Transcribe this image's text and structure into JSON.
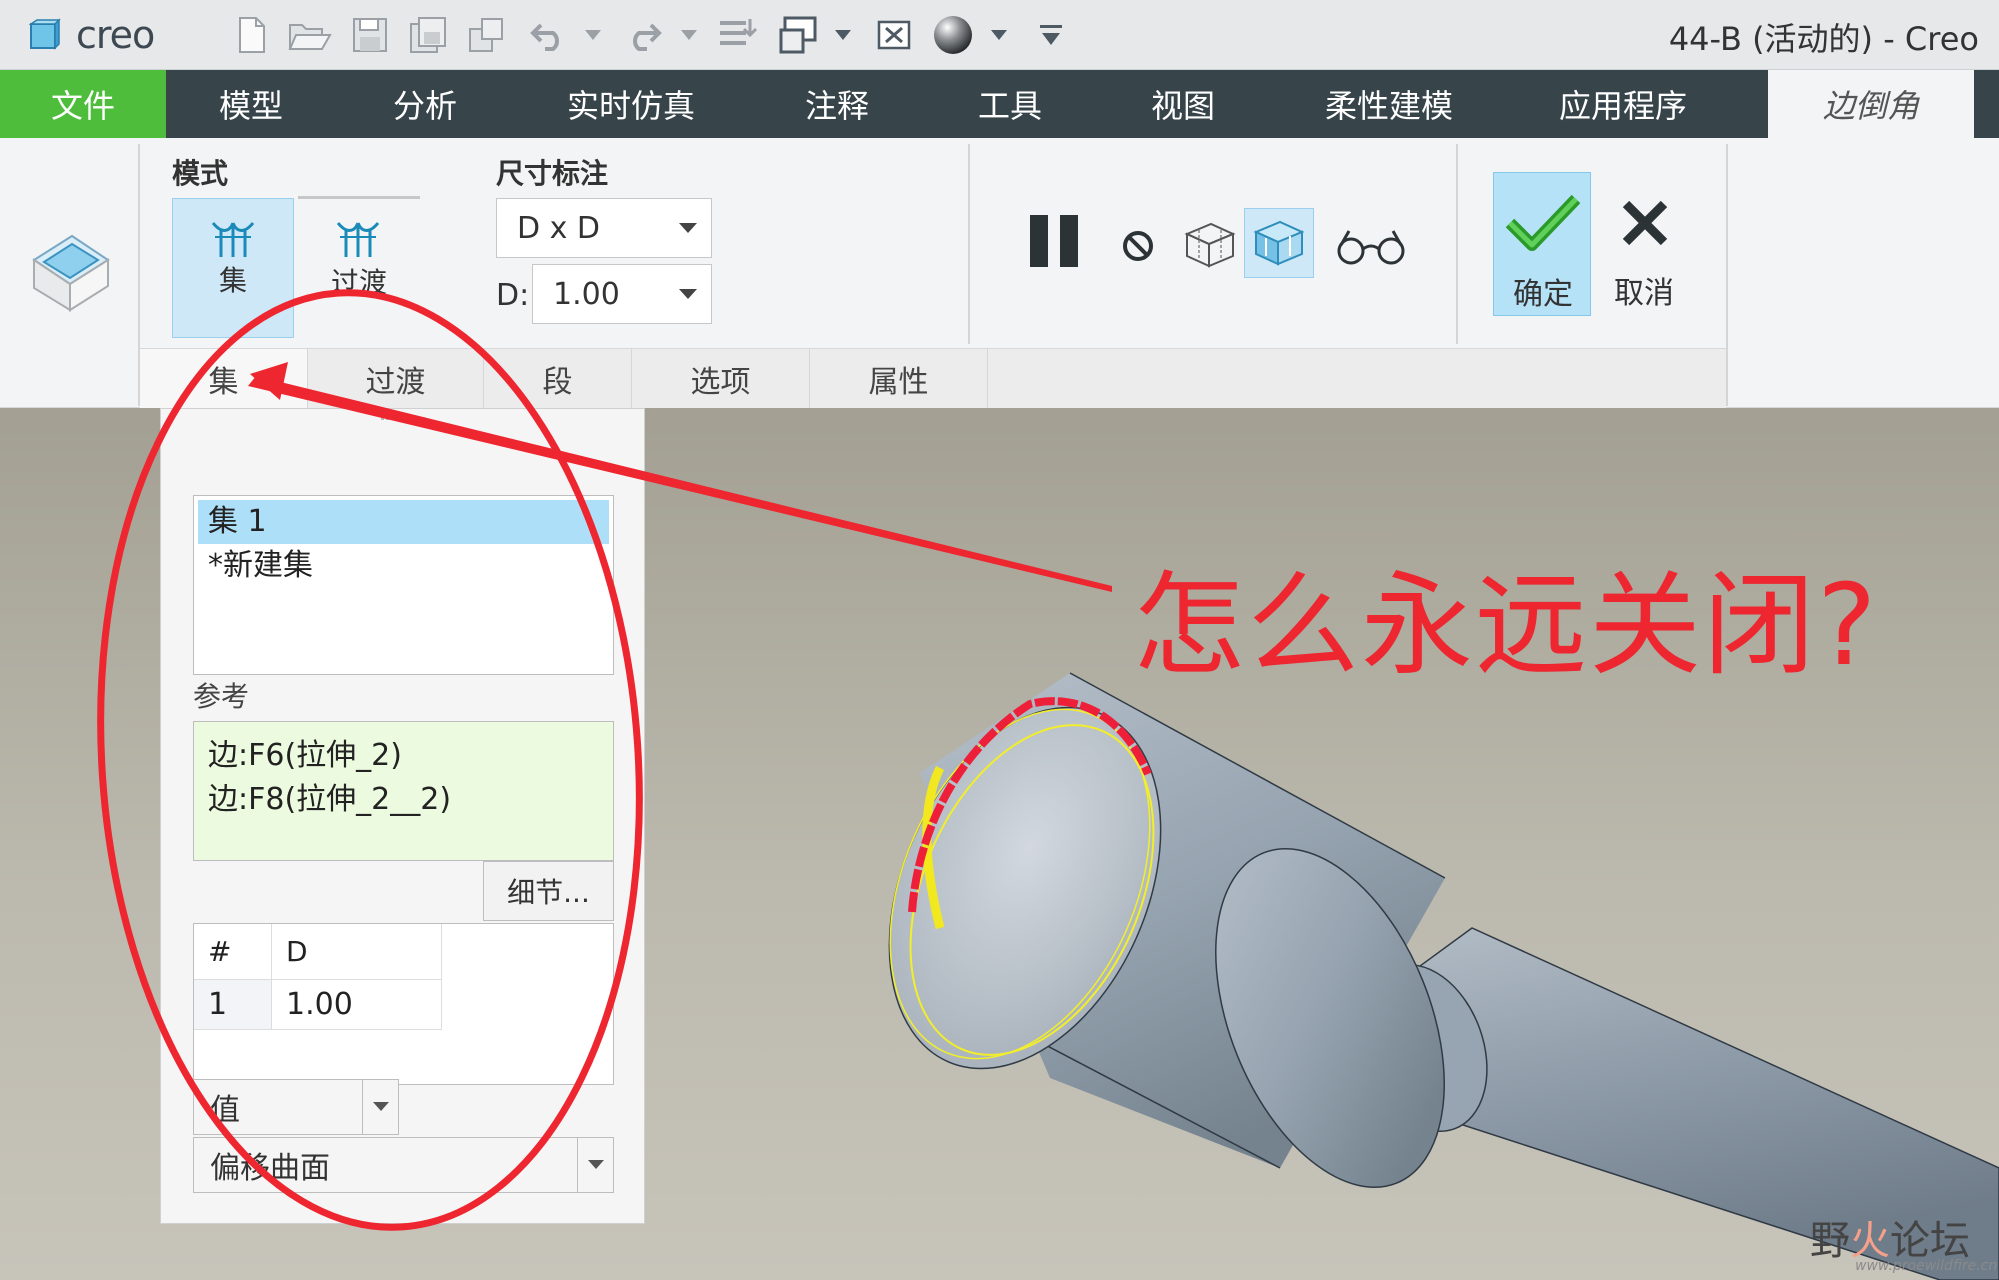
{
  "app": {
    "logo_text": "creo",
    "window_title": "44-B (活动的) - Creo"
  },
  "menu": {
    "items": [
      "文件",
      "模型",
      "分析",
      "实时仿真",
      "注释",
      "工具",
      "视图",
      "柔性建模",
      "应用程序"
    ],
    "active_tab": "边倒角"
  },
  "ribbon": {
    "mode_group": {
      "label": "模式",
      "buttons": [
        {
          "label": "集",
          "selected": true
        },
        {
          "label": "过渡",
          "selected": false
        }
      ]
    },
    "dimension_group": {
      "label": "尺寸标注",
      "type_value": "D x D",
      "d_label": "D:",
      "d_value": "1.00"
    },
    "ok_label": "确定",
    "cancel_label": "取消"
  },
  "tabs": [
    "集",
    "过渡",
    "段",
    "选项",
    "属性"
  ],
  "panel": {
    "sets": [
      "集 1",
      "*新建集"
    ],
    "ref_label": "参考",
    "refs": [
      "边:F6(拉伸_2)",
      "边:F8(拉伸_2__2)"
    ],
    "detail_button": "细节...",
    "table": {
      "headers": [
        "#",
        "D"
      ],
      "rows": [
        [
          "1",
          "1.00"
        ]
      ]
    },
    "value_dropdown": "值",
    "method_dropdown": "偏移曲面"
  },
  "annotation": {
    "question": "怎么永远关闭?"
  },
  "watermark": {
    "prefix": "野",
    "fire": "火",
    "suffix": "论坛",
    "url": "www.proewildfire.cn"
  },
  "colors": {
    "menu_bg": "#37454b",
    "file_tab": "#4fbd3c",
    "annotation_red": "#ee2630",
    "selection_blue": "#aedff8",
    "reference_green": "#ecfadf",
    "model_gray": "#96a3b0"
  }
}
